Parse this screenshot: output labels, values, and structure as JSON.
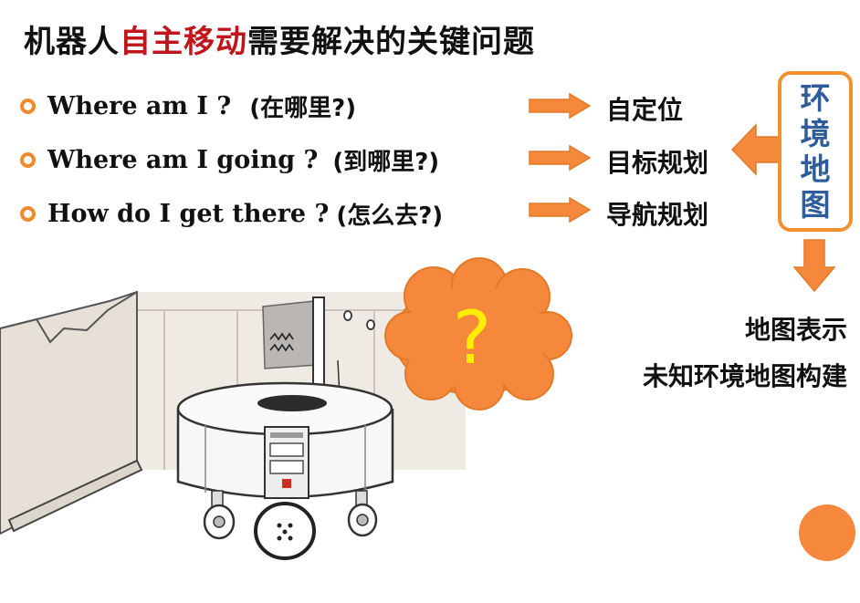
{
  "title": {
    "part1": "机器人",
    "highlight": "自主移动",
    "part2": "需要解决的关键问题",
    "highlight_color": "#c0151b"
  },
  "questions": [
    {
      "en": "Where am I ?",
      "zh": "(在哪里?)",
      "answer": "自定位"
    },
    {
      "en": "Where am I going ?",
      "zh": "(到哪里?)",
      "answer": "目标规划"
    },
    {
      "en": "How do I get there ?",
      "zh": "(怎么去?)",
      "answer": "导航规划"
    }
  ],
  "env_map": {
    "label": "环境地图"
  },
  "map_tasks": [
    "地图表示",
    "未知环境地图构建"
  ],
  "cloud": {
    "symbol": "?"
  },
  "colors": {
    "accent_orange": "#f08a2c",
    "arrow_fill": "#f5883b",
    "env_map_text": "#2f5c9b",
    "question_mark": "#ffee00"
  }
}
